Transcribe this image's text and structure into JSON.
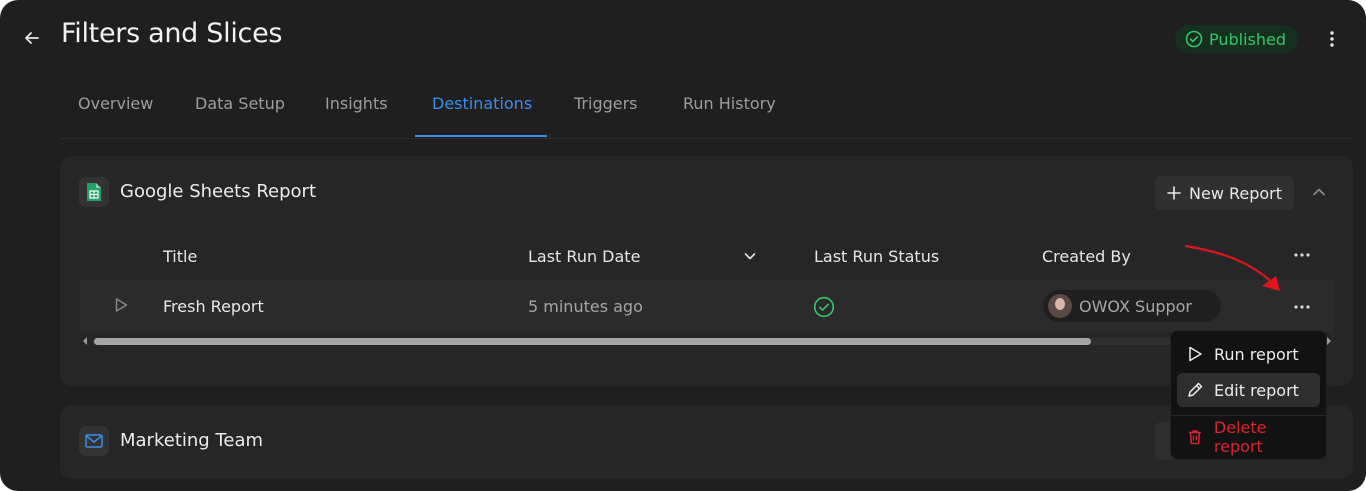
{
  "header": {
    "title": "Filters and Slices",
    "status": "Published",
    "status_color": "#35c66a"
  },
  "tabs": [
    {
      "label": "Overview",
      "active": false
    },
    {
      "label": "Data Setup",
      "active": false
    },
    {
      "label": "Insights",
      "active": false
    },
    {
      "label": "Destinations",
      "active": true
    },
    {
      "label": "Triggers",
      "active": false
    },
    {
      "label": "Run History",
      "active": false
    }
  ],
  "accent_color": "#3d8ee8",
  "destinations": [
    {
      "title": "Google Sheets Report",
      "icon": "google-sheets-icon",
      "new_report_label": "New Report",
      "columns": [
        "Title",
        "Last Run Date",
        "Last Run Status",
        "Created By"
      ],
      "rows": [
        {
          "title": "Fresh Report",
          "last_run_date": "5 minutes ago",
          "last_run_status": "success",
          "created_by": "OWOX Suppor"
        }
      ]
    },
    {
      "title": "Marketing Team",
      "icon": "mail-icon"
    }
  ],
  "context_menu": {
    "items": [
      {
        "label": "Run report",
        "icon": "play-icon",
        "hovered": false,
        "danger": false
      },
      {
        "label": "Edit report",
        "icon": "pencil-icon",
        "hovered": true,
        "danger": false
      },
      {
        "label": "Delete report",
        "icon": "trash-icon",
        "hovered": false,
        "danger": true
      }
    ]
  },
  "annotation_arrow_color": "#e0141e"
}
